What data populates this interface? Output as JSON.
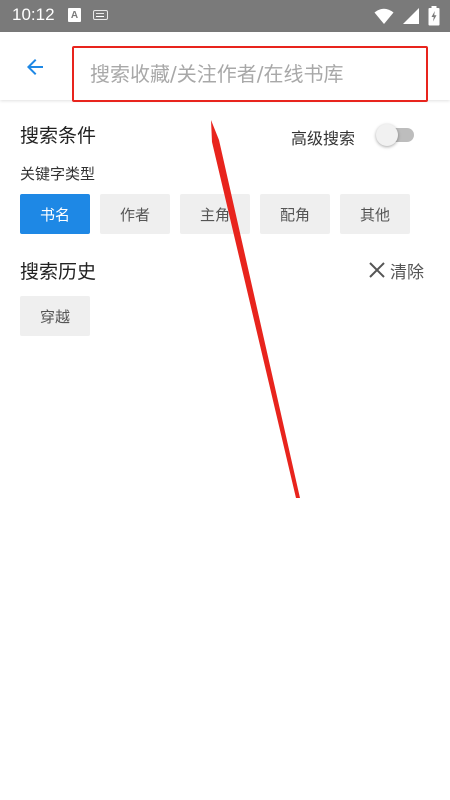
{
  "status_bar": {
    "time": "10:12",
    "a_badge": "A",
    "icons": [
      "a-icon",
      "keyboard-icon",
      "wifi-icon",
      "signal-icon",
      "battery-charging-icon"
    ]
  },
  "header": {
    "search_placeholder": "搜索收藏/关注作者/在线书库",
    "search_value": ""
  },
  "conditions": {
    "title": "搜索条件",
    "advanced_label": "高级搜索",
    "advanced_enabled": false,
    "keyword_type_label": "关键字类型",
    "keyword_types": [
      {
        "label": "书名",
        "selected": true
      },
      {
        "label": "作者",
        "selected": false
      },
      {
        "label": "主角",
        "selected": false
      },
      {
        "label": "配角",
        "selected": false
      },
      {
        "label": "其他",
        "selected": false
      }
    ]
  },
  "history": {
    "title": "搜索历史",
    "clear_label": "清除",
    "items": [
      "穿越"
    ]
  },
  "colors": {
    "accent": "#1e88e5",
    "annotation": "#e8241d",
    "status_bar": "#7a7a7a"
  }
}
